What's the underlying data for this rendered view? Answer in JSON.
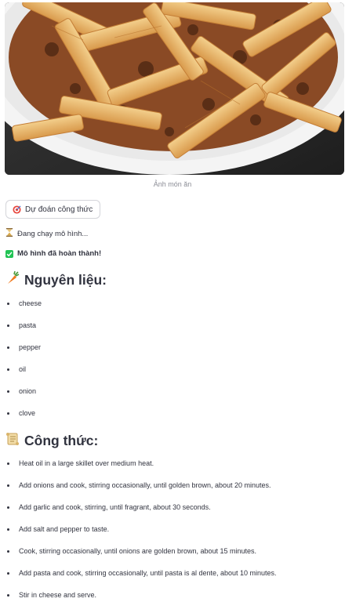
{
  "image": {
    "caption": "Ảnh món ăn",
    "alt": "pasta dish"
  },
  "predict_button": {
    "icon": "target-icon",
    "label": "Dự đoán công thức"
  },
  "status_running": {
    "icon": "hourglass-icon",
    "text": "Đang chạy mô hình..."
  },
  "status_done": {
    "icon": "check-icon",
    "text": "Mô hình đã hoàn thành!"
  },
  "ingredients": {
    "icon": "carrot-icon",
    "title": "Nguyên liệu:",
    "items": [
      "cheese",
      "pasta",
      "pepper",
      "oil",
      "onion",
      "clove"
    ]
  },
  "recipe": {
    "icon": "scroll-icon",
    "title": "Công thức:",
    "steps": [
      "Heat oil in a large skillet over medium heat.",
      "Add onions and cook, stirring occasionally, until golden brown, about 20 minutes.",
      "Add garlic and cook, stirring, until fragrant, about 30 seconds.",
      "Add salt and pepper to taste.",
      "Cook, stirring occasionally, until onions are golden brown, about 15 minutes.",
      "Add pasta and cook, stirring occasionally, until pasta is al dente, about 10 minutes.",
      "Stir in cheese and serve."
    ]
  },
  "colors": {
    "success": "#21c354",
    "text": "#31333f",
    "caption": "#8b8d96"
  }
}
